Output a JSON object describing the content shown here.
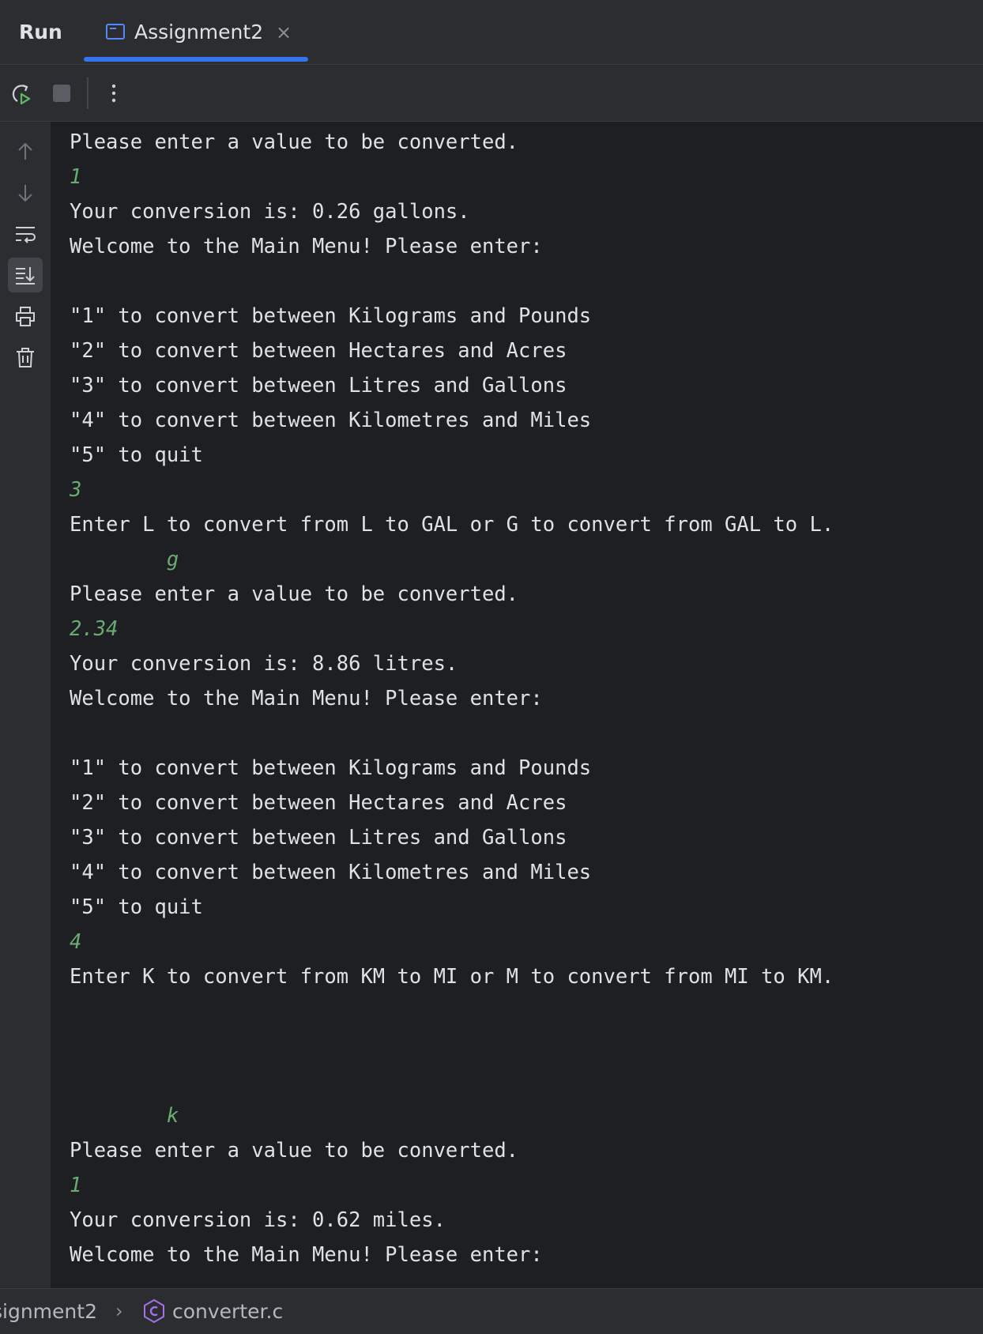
{
  "tabbar": {
    "run_label": "Run",
    "tab_label": "Assignment2",
    "close_glyph": "×"
  },
  "console": {
    "lines": [
      {
        "text": "Please enter a value to be converted.",
        "kind": "output"
      },
      {
        "text": "1",
        "kind": "input"
      },
      {
        "text": "Your conversion is: 0.26 gallons.",
        "kind": "output"
      },
      {
        "text": "Welcome to the Main Menu! Please enter:",
        "kind": "output"
      },
      {
        "text": "",
        "kind": "output"
      },
      {
        "text": "\"1\" to convert between Kilograms and Pounds",
        "kind": "output"
      },
      {
        "text": "\"2\" to convert between Hectares and Acres",
        "kind": "output"
      },
      {
        "text": "\"3\" to convert between Litres and Gallons",
        "kind": "output"
      },
      {
        "text": "\"4\" to convert between Kilometres and Miles",
        "kind": "output"
      },
      {
        "text": "\"5\" to quit",
        "kind": "output"
      },
      {
        "text": "3",
        "kind": "input"
      },
      {
        "text": "Enter L to convert from L to GAL or G to convert from GAL to L.",
        "kind": "output"
      },
      {
        "text": "        g",
        "kind": "input"
      },
      {
        "text": "Please enter a value to be converted.",
        "kind": "output"
      },
      {
        "text": "2.34",
        "kind": "input"
      },
      {
        "text": "Your conversion is: 8.86 litres.",
        "kind": "output"
      },
      {
        "text": "Welcome to the Main Menu! Please enter:",
        "kind": "output"
      },
      {
        "text": "",
        "kind": "output"
      },
      {
        "text": "\"1\" to convert between Kilograms and Pounds",
        "kind": "output"
      },
      {
        "text": "\"2\" to convert between Hectares and Acres",
        "kind": "output"
      },
      {
        "text": "\"3\" to convert between Litres and Gallons",
        "kind": "output"
      },
      {
        "text": "\"4\" to convert between Kilometres and Miles",
        "kind": "output"
      },
      {
        "text": "\"5\" to quit",
        "kind": "output"
      },
      {
        "text": "4",
        "kind": "input"
      },
      {
        "text": "Enter K to convert from KM to MI or M to convert from MI to KM.",
        "kind": "output"
      },
      {
        "text": "",
        "kind": "output"
      },
      {
        "text": "",
        "kind": "output"
      },
      {
        "text": "",
        "kind": "output"
      },
      {
        "text": "        k",
        "kind": "input"
      },
      {
        "text": "Please enter a value to be converted.",
        "kind": "output"
      },
      {
        "text": "1",
        "kind": "input"
      },
      {
        "text": "Your conversion is: 0.62 miles.",
        "kind": "output"
      },
      {
        "text": "Welcome to the Main Menu! Please enter:",
        "kind": "output"
      }
    ]
  },
  "statusbar": {
    "project": "signment2",
    "file": "converter.c"
  },
  "icons": {
    "rerun": "rerun-icon",
    "stop": "stop-icon",
    "more": "more-options-icon",
    "up": "arrow-up-icon",
    "down": "arrow-down-icon",
    "wrap": "soft-wrap-icon",
    "scroll": "scroll-to-end-icon",
    "print": "print-icon",
    "trash": "trash-icon"
  },
  "colors": {
    "accent": "#3574f0",
    "input_text": "#6aab73",
    "console_bg": "#1e1f22"
  }
}
